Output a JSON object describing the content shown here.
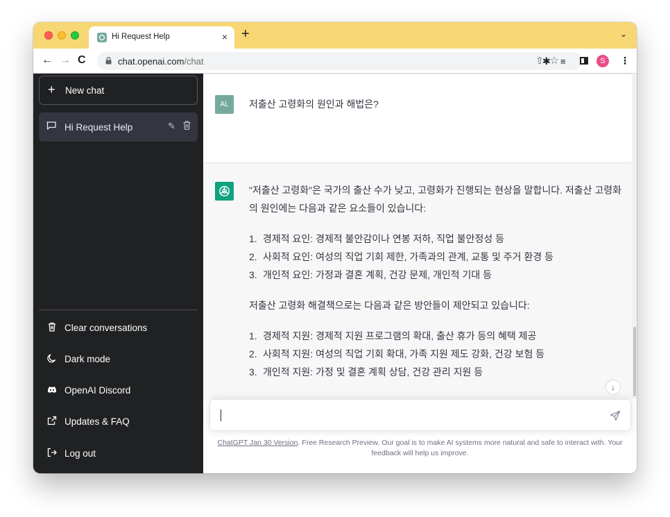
{
  "browser": {
    "tab_title": "Hi Request Help",
    "tab_close": "×",
    "new_tab": "+",
    "tab_menu": "⌄",
    "url_host": "chat.openai.com",
    "url_path": "/chat",
    "profile_initial": "S",
    "colors": {
      "tabbar": "#f7d774",
      "profile": "#e94e8a"
    }
  },
  "sidebar": {
    "new_chat": "New chat",
    "conversations": [
      {
        "title": "Hi Request Help"
      }
    ],
    "items": [
      {
        "label": "Clear conversations",
        "icon": "trash-icon"
      },
      {
        "label": "Dark mode",
        "icon": "moon-icon"
      },
      {
        "label": "OpenAI Discord",
        "icon": "discord-icon"
      },
      {
        "label": "Updates & FAQ",
        "icon": "external-link-icon"
      },
      {
        "label": "Log out",
        "icon": "logout-icon"
      }
    ]
  },
  "chat": {
    "user_avatar": "AL",
    "user_message": "저출산 고령화의 원인과 해법은?",
    "assistant_intro": "\"저출산 고령화\"은 국가의 출산 수가 낮고, 고령화가 진행되는 현상을 말합니다. 저출산 고령화의 원인에는 다음과 같은 요소들이 있습니다:",
    "causes": [
      {
        "num": "1.",
        "text": "경제적 요인: 경제적 불안감이나 연봉 저하, 직업 불안정성 등"
      },
      {
        "num": "2.",
        "text": "사회적 요인: 여성의 직업 기회 제한, 가족과의 관계, 교통 및 주거 환경 등"
      },
      {
        "num": "3.",
        "text": "개인적 요인: 가정과 결혼 계획, 건강 문제, 개인적 기대 등"
      }
    ],
    "solutions_intro": "저출산 고령화 해결책으로는 다음과 같은 방안들이 제안되고 있습니다:",
    "solutions": [
      {
        "num": "1.",
        "text": "경제적 지원: 경제적 지원 프로그램의 확대, 출산 휴가 등의 혜택 제공"
      },
      {
        "num": "2.",
        "text": "사회적 지원: 여성의 직업 기회 확대, 가족 지원 제도 강화, 건강 보험 등"
      },
      {
        "num": "3.",
        "text": "개인적 지원: 가정 및 결혼 계획 상담, 건강 관리 지원 등"
      }
    ]
  },
  "footer": {
    "version_link": "ChatGPT Jan 30 Version",
    "text": ". Free Research Preview. Our goal is to make AI systems more natural and safe to interact with. Your feedback will help us improve."
  }
}
